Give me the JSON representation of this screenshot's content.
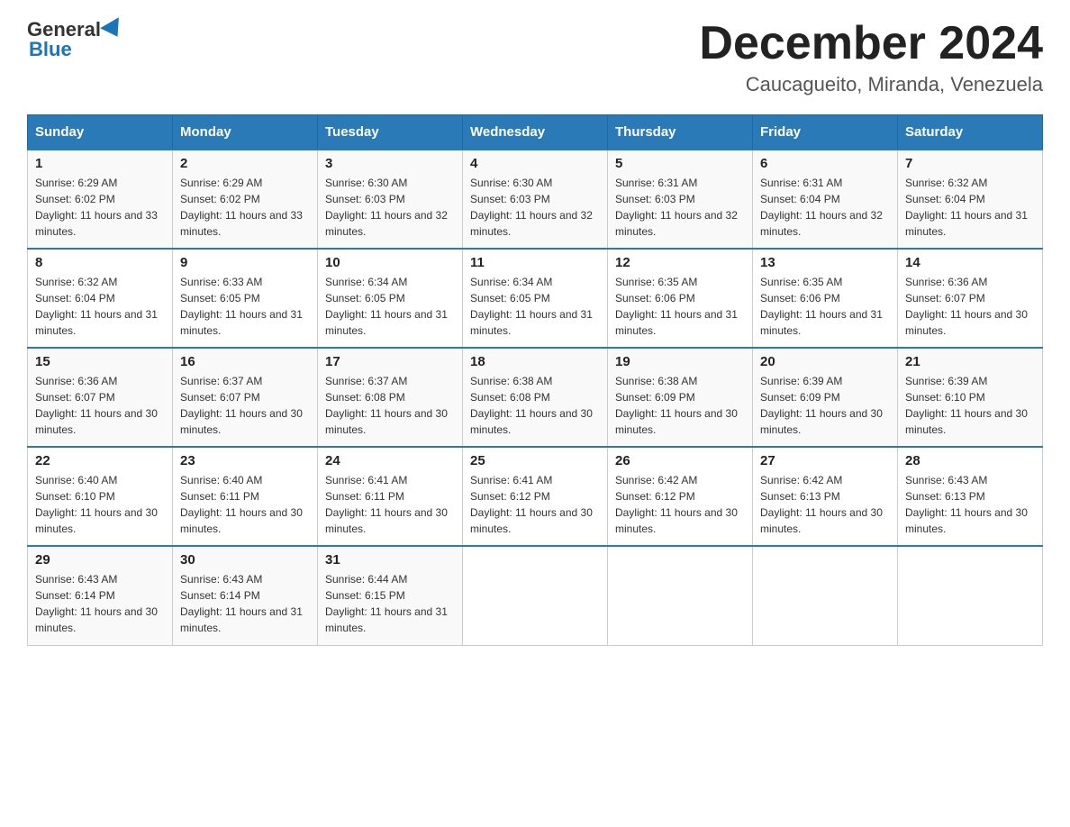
{
  "logo": {
    "part1": "General",
    "part2": "Blue"
  },
  "title": "December 2024",
  "location": "Caucagueito, Miranda, Venezuela",
  "days_of_week": [
    "Sunday",
    "Monday",
    "Tuesday",
    "Wednesday",
    "Thursday",
    "Friday",
    "Saturday"
  ],
  "weeks": [
    [
      {
        "day": "1",
        "sunrise": "6:29 AM",
        "sunset": "6:02 PM",
        "daylight": "11 hours and 33 minutes."
      },
      {
        "day": "2",
        "sunrise": "6:29 AM",
        "sunset": "6:02 PM",
        "daylight": "11 hours and 33 minutes."
      },
      {
        "day": "3",
        "sunrise": "6:30 AM",
        "sunset": "6:03 PM",
        "daylight": "11 hours and 32 minutes."
      },
      {
        "day": "4",
        "sunrise": "6:30 AM",
        "sunset": "6:03 PM",
        "daylight": "11 hours and 32 minutes."
      },
      {
        "day": "5",
        "sunrise": "6:31 AM",
        "sunset": "6:03 PM",
        "daylight": "11 hours and 32 minutes."
      },
      {
        "day": "6",
        "sunrise": "6:31 AM",
        "sunset": "6:04 PM",
        "daylight": "11 hours and 32 minutes."
      },
      {
        "day": "7",
        "sunrise": "6:32 AM",
        "sunset": "6:04 PM",
        "daylight": "11 hours and 31 minutes."
      }
    ],
    [
      {
        "day": "8",
        "sunrise": "6:32 AM",
        "sunset": "6:04 PM",
        "daylight": "11 hours and 31 minutes."
      },
      {
        "day": "9",
        "sunrise": "6:33 AM",
        "sunset": "6:05 PM",
        "daylight": "11 hours and 31 minutes."
      },
      {
        "day": "10",
        "sunrise": "6:34 AM",
        "sunset": "6:05 PM",
        "daylight": "11 hours and 31 minutes."
      },
      {
        "day": "11",
        "sunrise": "6:34 AM",
        "sunset": "6:05 PM",
        "daylight": "11 hours and 31 minutes."
      },
      {
        "day": "12",
        "sunrise": "6:35 AM",
        "sunset": "6:06 PM",
        "daylight": "11 hours and 31 minutes."
      },
      {
        "day": "13",
        "sunrise": "6:35 AM",
        "sunset": "6:06 PM",
        "daylight": "11 hours and 31 minutes."
      },
      {
        "day": "14",
        "sunrise": "6:36 AM",
        "sunset": "6:07 PM",
        "daylight": "11 hours and 30 minutes."
      }
    ],
    [
      {
        "day": "15",
        "sunrise": "6:36 AM",
        "sunset": "6:07 PM",
        "daylight": "11 hours and 30 minutes."
      },
      {
        "day": "16",
        "sunrise": "6:37 AM",
        "sunset": "6:07 PM",
        "daylight": "11 hours and 30 minutes."
      },
      {
        "day": "17",
        "sunrise": "6:37 AM",
        "sunset": "6:08 PM",
        "daylight": "11 hours and 30 minutes."
      },
      {
        "day": "18",
        "sunrise": "6:38 AM",
        "sunset": "6:08 PM",
        "daylight": "11 hours and 30 minutes."
      },
      {
        "day": "19",
        "sunrise": "6:38 AM",
        "sunset": "6:09 PM",
        "daylight": "11 hours and 30 minutes."
      },
      {
        "day": "20",
        "sunrise": "6:39 AM",
        "sunset": "6:09 PM",
        "daylight": "11 hours and 30 minutes."
      },
      {
        "day": "21",
        "sunrise": "6:39 AM",
        "sunset": "6:10 PM",
        "daylight": "11 hours and 30 minutes."
      }
    ],
    [
      {
        "day": "22",
        "sunrise": "6:40 AM",
        "sunset": "6:10 PM",
        "daylight": "11 hours and 30 minutes."
      },
      {
        "day": "23",
        "sunrise": "6:40 AM",
        "sunset": "6:11 PM",
        "daylight": "11 hours and 30 minutes."
      },
      {
        "day": "24",
        "sunrise": "6:41 AM",
        "sunset": "6:11 PM",
        "daylight": "11 hours and 30 minutes."
      },
      {
        "day": "25",
        "sunrise": "6:41 AM",
        "sunset": "6:12 PM",
        "daylight": "11 hours and 30 minutes."
      },
      {
        "day": "26",
        "sunrise": "6:42 AM",
        "sunset": "6:12 PM",
        "daylight": "11 hours and 30 minutes."
      },
      {
        "day": "27",
        "sunrise": "6:42 AM",
        "sunset": "6:13 PM",
        "daylight": "11 hours and 30 minutes."
      },
      {
        "day": "28",
        "sunrise": "6:43 AM",
        "sunset": "6:13 PM",
        "daylight": "11 hours and 30 minutes."
      }
    ],
    [
      {
        "day": "29",
        "sunrise": "6:43 AM",
        "sunset": "6:14 PM",
        "daylight": "11 hours and 30 minutes."
      },
      {
        "day": "30",
        "sunrise": "6:43 AM",
        "sunset": "6:14 PM",
        "daylight": "11 hours and 31 minutes."
      },
      {
        "day": "31",
        "sunrise": "6:44 AM",
        "sunset": "6:15 PM",
        "daylight": "11 hours and 31 minutes."
      },
      null,
      null,
      null,
      null
    ]
  ]
}
